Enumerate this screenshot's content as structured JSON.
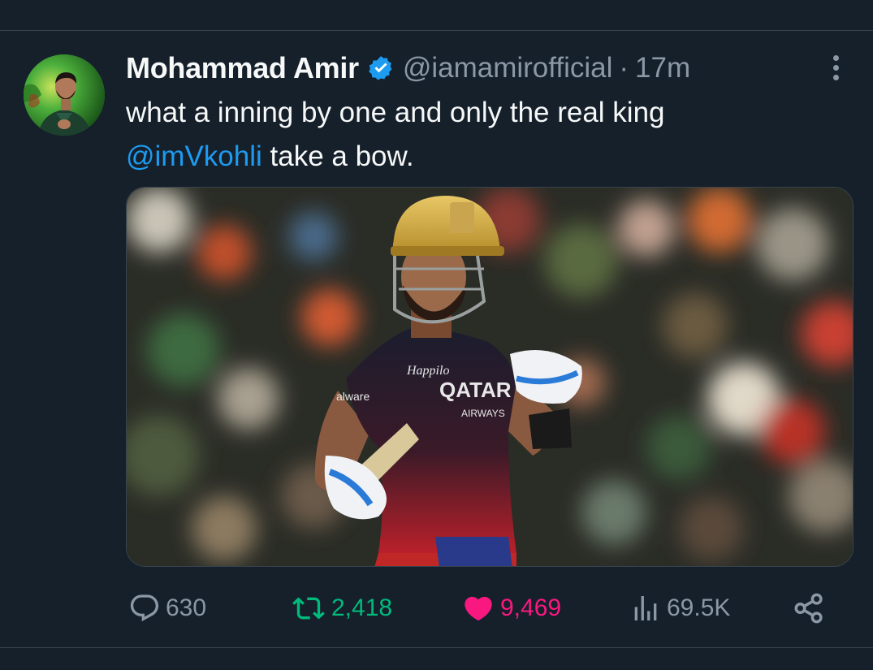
{
  "tweet": {
    "display_name": "Mohammad Amir",
    "handle": "@iamamirofficial",
    "separator": "·",
    "timestamp": "17m",
    "text_line1": "what a inning by one and only the real king",
    "mention": "@imVkohli",
    "text_line2_rest": " take a bow.",
    "media_description_icon": "photo"
  },
  "actions": {
    "replies": "630",
    "retweets": "2,418",
    "likes": "9,469",
    "views": "69.5K"
  },
  "colors": {
    "background": "#15202b",
    "divider": "#38444d",
    "secondary_text": "#8b98a5",
    "link": "#1d9bf0",
    "retweet_active": "#00ba7c",
    "like_active": "#f91880",
    "verified_badge": "#1d9bf0"
  },
  "icons": [
    "verified-badge-icon",
    "more-options-icon",
    "reply-icon",
    "retweet-icon",
    "heart-icon",
    "views-icon",
    "share-icon"
  ]
}
